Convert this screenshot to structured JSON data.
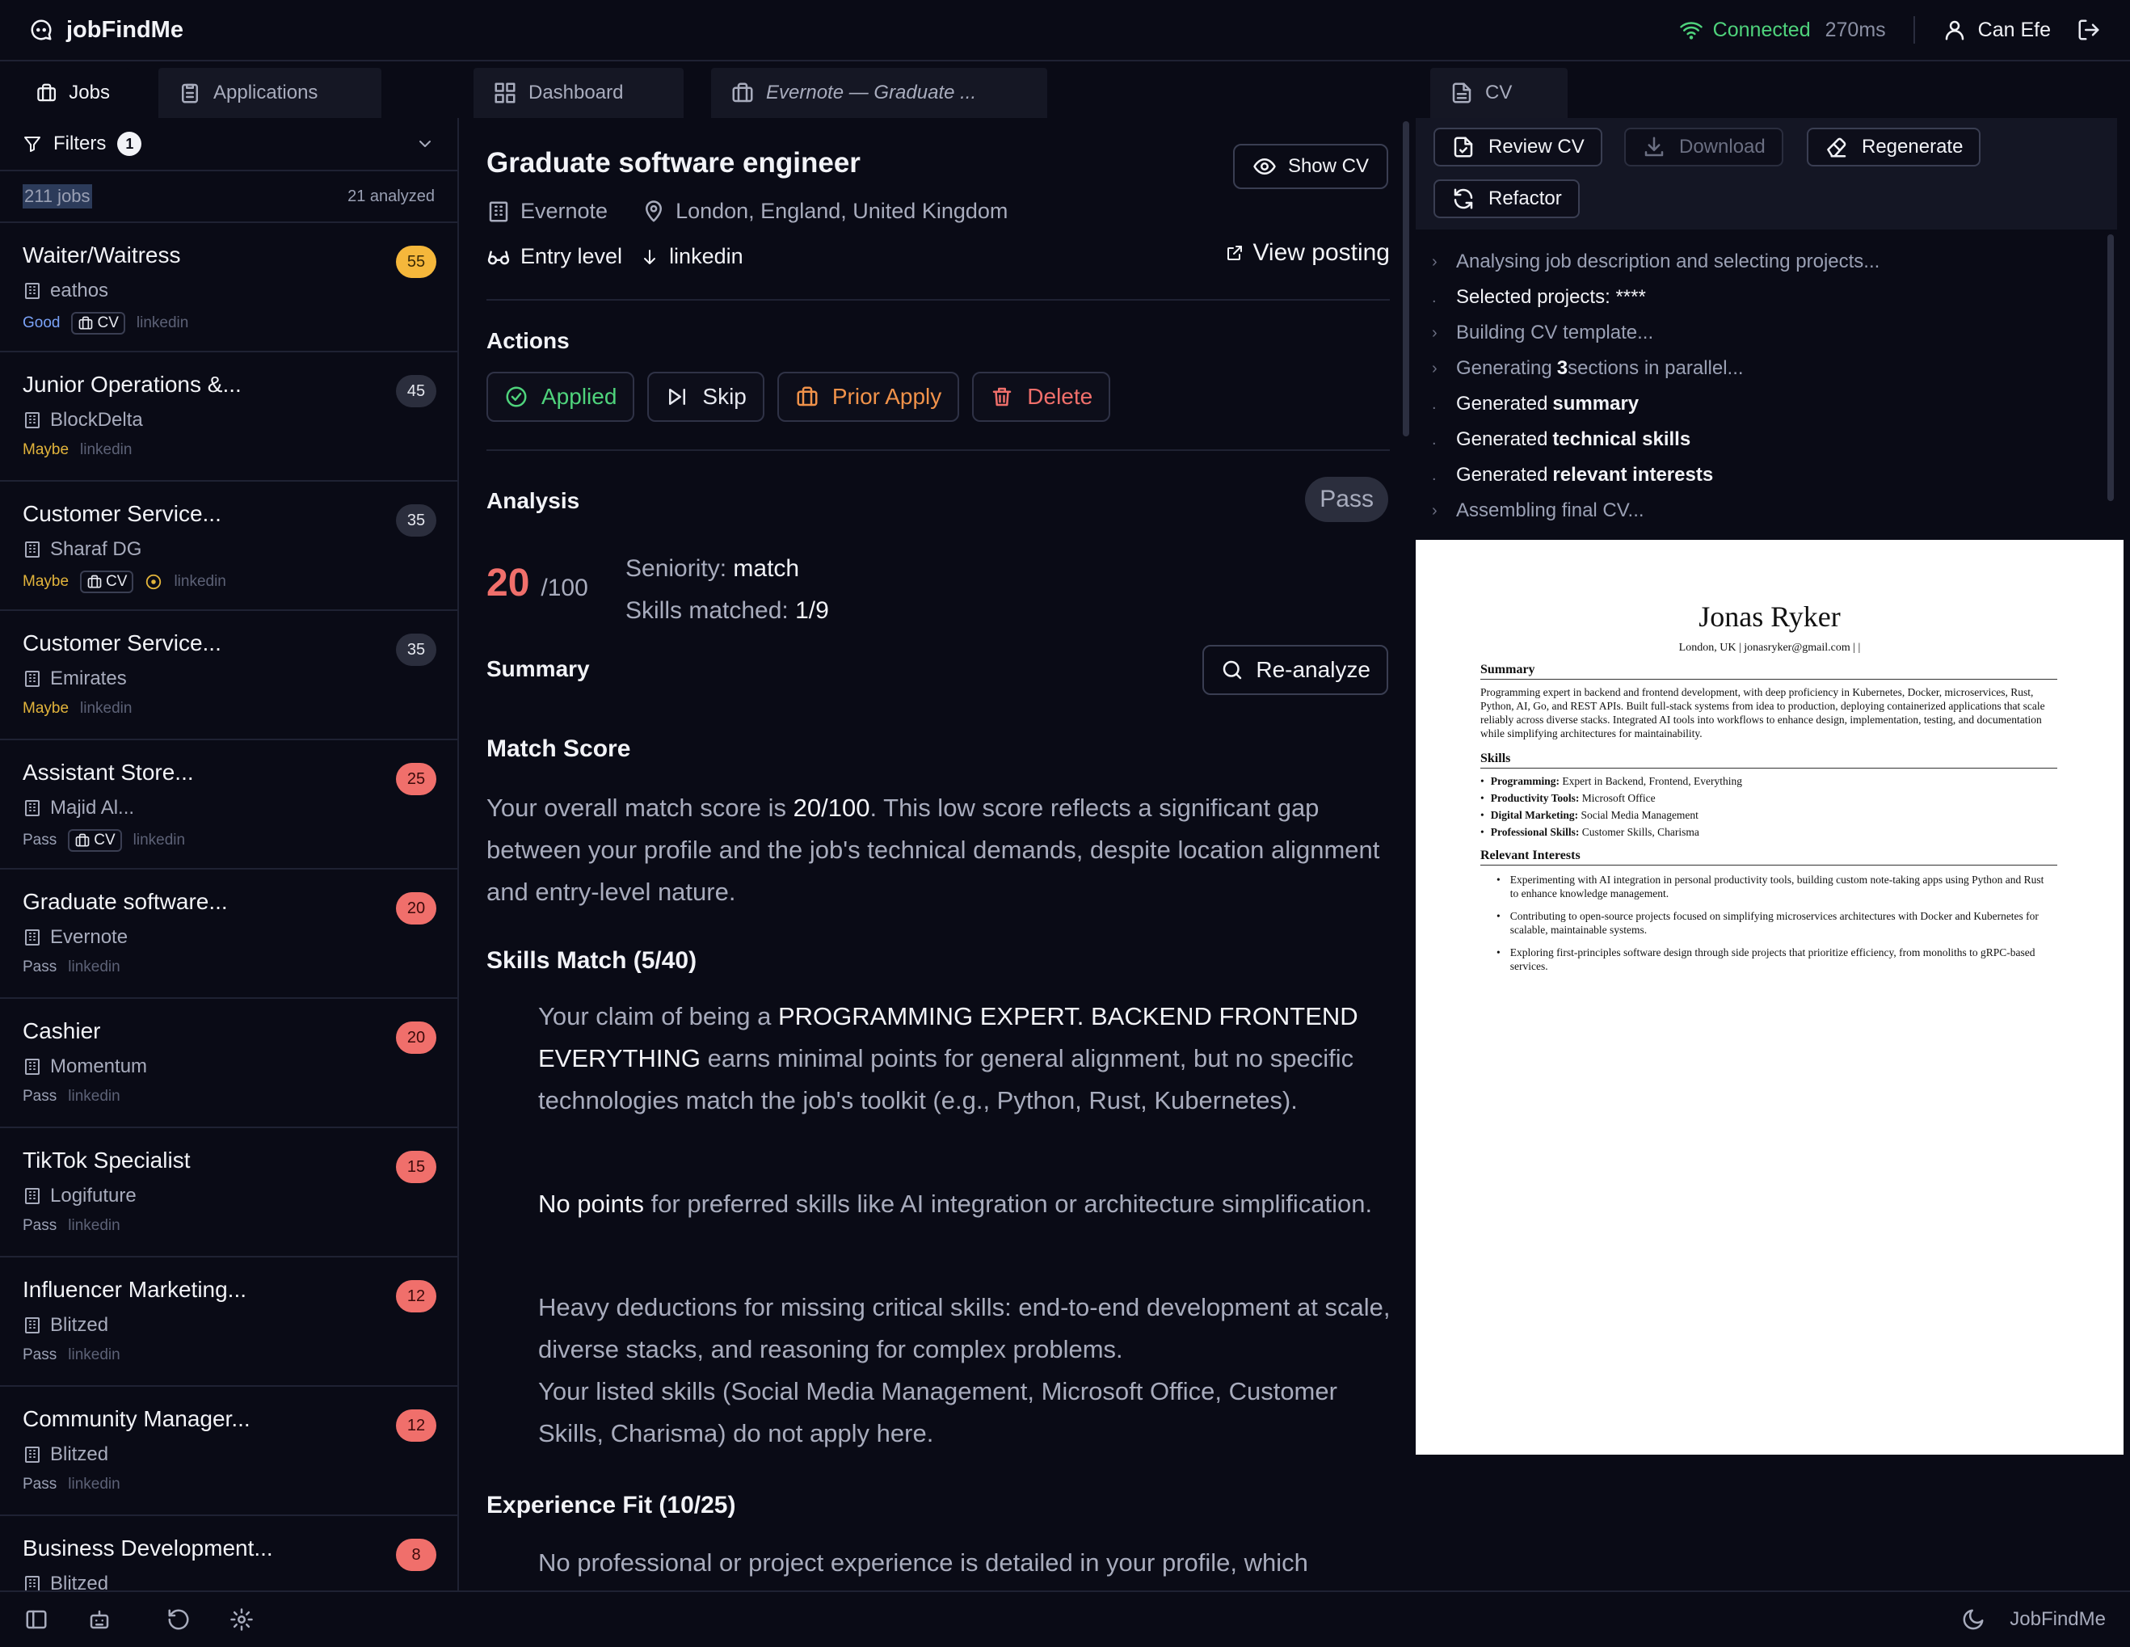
{
  "app": {
    "brand": "jobFindMe",
    "connection": "Connected",
    "latency": "270ms",
    "user": "Can Efe"
  },
  "tabs": [
    {
      "label": "Jobs"
    },
    {
      "label": "Applications"
    },
    {
      "label": "Dashboard"
    },
    {
      "label": "Evernote — Graduate ..."
    },
    {
      "label": "CV"
    }
  ],
  "sidebar": {
    "filters_label": "Filters",
    "filters_count": "1",
    "job_count": "211 jobs",
    "analyzed": "21 analyzed",
    "jobs": [
      {
        "title": "Waiter/Waitress",
        "company": "eathos",
        "label": "Good",
        "cv": "CV",
        "source": "linkedin",
        "score": "55"
      },
      {
        "title": "Junior Operations &...",
        "company": "BlockDelta",
        "label": "Maybe",
        "source": "linkedin",
        "score": "45"
      },
      {
        "title": "Customer Service...",
        "company": "Sharaf DG",
        "label": "Maybe",
        "cv": "CV",
        "source": "linkedin",
        "score": "35"
      },
      {
        "title": "Customer Service...",
        "company": "Emirates",
        "label": "Maybe",
        "source": "linkedin",
        "score": "35"
      },
      {
        "title": "Assistant Store...",
        "company": "Majid Al...",
        "label": "Pass",
        "cv": "CV",
        "source": "linkedin",
        "score": "25"
      },
      {
        "title": "Graduate software...",
        "company": "Evernote",
        "label": "Pass",
        "source": "linkedin",
        "score": "20"
      },
      {
        "title": "Cashier",
        "company": "Momentum",
        "label": "Pass",
        "source": "linkedin",
        "score": "20"
      },
      {
        "title": "TikTok Specialist",
        "company": "Logifuture",
        "label": "Pass",
        "source": "linkedin",
        "score": "15"
      },
      {
        "title": "Influencer Marketing...",
        "company": "Blitzed",
        "label": "Pass",
        "source": "linkedin",
        "score": "12"
      },
      {
        "title": "Community Manager...",
        "company": "Blitzed",
        "label": "Pass",
        "source": "linkedin",
        "score": "12"
      },
      {
        "title": "Business Development...",
        "company": "Blitzed",
        "label": "",
        "source": "",
        "score": "8"
      }
    ]
  },
  "job": {
    "title": "Graduate software engineer",
    "show_cv": "Show CV",
    "company": "Evernote",
    "location": "London, England, United Kingdom",
    "level": "Entry level",
    "source": "linkedin",
    "view_posting": "View posting",
    "actions_heading": "Actions",
    "actions": {
      "applied": "Applied",
      "skip": "Skip",
      "prior": "Prior Apply",
      "delete": "Delete"
    },
    "analysis_heading": "Analysis",
    "verdict": "Pass",
    "score": "20",
    "score_max": "/100",
    "seniority_label": "Seniority:",
    "seniority_value": "match",
    "skills_label": "Skills matched:",
    "skills_value": "1/9",
    "summary_heading": "Summary",
    "reanalyze": "Re-analyze",
    "match_heading": "Match Score",
    "match_p1": "Your overall match score is ",
    "match_score": "20/100",
    "match_p2": ". This low score reflects a significant gap between your profile and the job's technical demands, despite location alignment and entry-level nature.",
    "skills_heading": "Skills Match (5/40)",
    "skills_p1a": "Your claim of being a ",
    "skills_p1b": "PROGRAMMING EXPERT. BACKEND FRONTEND EVERYTHING",
    "skills_p1c": " earns minimal points for general alignment, but no specific technologies match the job's toolkit (e.g., Python, Rust, Kubernetes).",
    "skills_p2a": "No points",
    "skills_p2b": " for preferred skills like AI integration or architecture simplification.",
    "skills_p3": "Heavy deductions for missing critical skills: end-to-end development at scale, diverse stacks, and reasoning for complex problems.",
    "skills_p4": "Your listed skills (Social Media Management, Microsoft Office, Customer Skills, Charisma) do not apply here.",
    "exp_heading": "Experience Fit (10/25)",
    "exp_p1": "No professional or project experience is detailed in your profile, which"
  },
  "cv_panel": {
    "review": "Review CV",
    "download": "Download",
    "regenerate": "Regenerate",
    "refactor": "Refactor",
    "log": [
      {
        "pre": "Analysing job description and selecting projects...",
        "bold": "",
        "post": "",
        "done": false
      },
      {
        "pre": "Selected projects: ****",
        "bold": "",
        "post": "",
        "done": true
      },
      {
        "pre": "Building CV template...",
        "bold": "",
        "post": "",
        "done": false
      },
      {
        "pre": "Generating ",
        "bold": "3",
        "post": " sections in parallel...",
        "done": false
      },
      {
        "pre": "Generated ",
        "bold": "summary",
        "post": "",
        "done": true
      },
      {
        "pre": "Generated ",
        "bold": "technical skills",
        "post": "",
        "done": true
      },
      {
        "pre": "Generated ",
        "bold": "relevant interests",
        "post": "",
        "done": true
      },
      {
        "pre": "Assembling final CV...",
        "bold": "",
        "post": "",
        "done": false
      }
    ]
  },
  "cv": {
    "name": "Jonas Ryker",
    "contact": "London, UK  |  jonasryker@gmail.com  |   |",
    "summary_heading": "Summary",
    "summary": "Programming expert in backend and frontend development, with deep proficiency in Kubernetes, Docker, microservices, Rust, Python, AI, Go, and REST APIs. Built full-stack systems from idea to production, deploying containerized applications that scale reliably across diverse stacks. Integrated AI tools into workflows to enhance design, implementation, testing, and documentation while simplifying architectures for maintainability.",
    "skills_heading": "Skills",
    "skills": [
      {
        "k": "Programming:",
        "v": " Expert in Backend, Frontend, Everything"
      },
      {
        "k": "Productivity Tools:",
        "v": " Microsoft Office"
      },
      {
        "k": "Digital Marketing:",
        "v": " Social Media Management"
      },
      {
        "k": "Professional Skills:",
        "v": " Customer Skills, Charisma"
      }
    ],
    "interests_heading": "Relevant Interests",
    "interests": [
      "Experimenting with AI integration in personal productivity tools, building custom note-taking apps using Python and Rust to enhance knowledge management.",
      "Contributing to open-source projects focused on simplifying microservices architectures with Docker and Kubernetes for scalable, maintainable systems.",
      "Exploring first-principles software design through side projects that prioritize efficiency, from monoliths to gRPC-based services."
    ]
  },
  "footer": {
    "brand": "JobFindMe"
  },
  "colors": {
    "accent_green": "#4fd37c",
    "score_red": "#f06f6b",
    "score_yellow": "#f5b73b",
    "background": "#0a0b16"
  }
}
